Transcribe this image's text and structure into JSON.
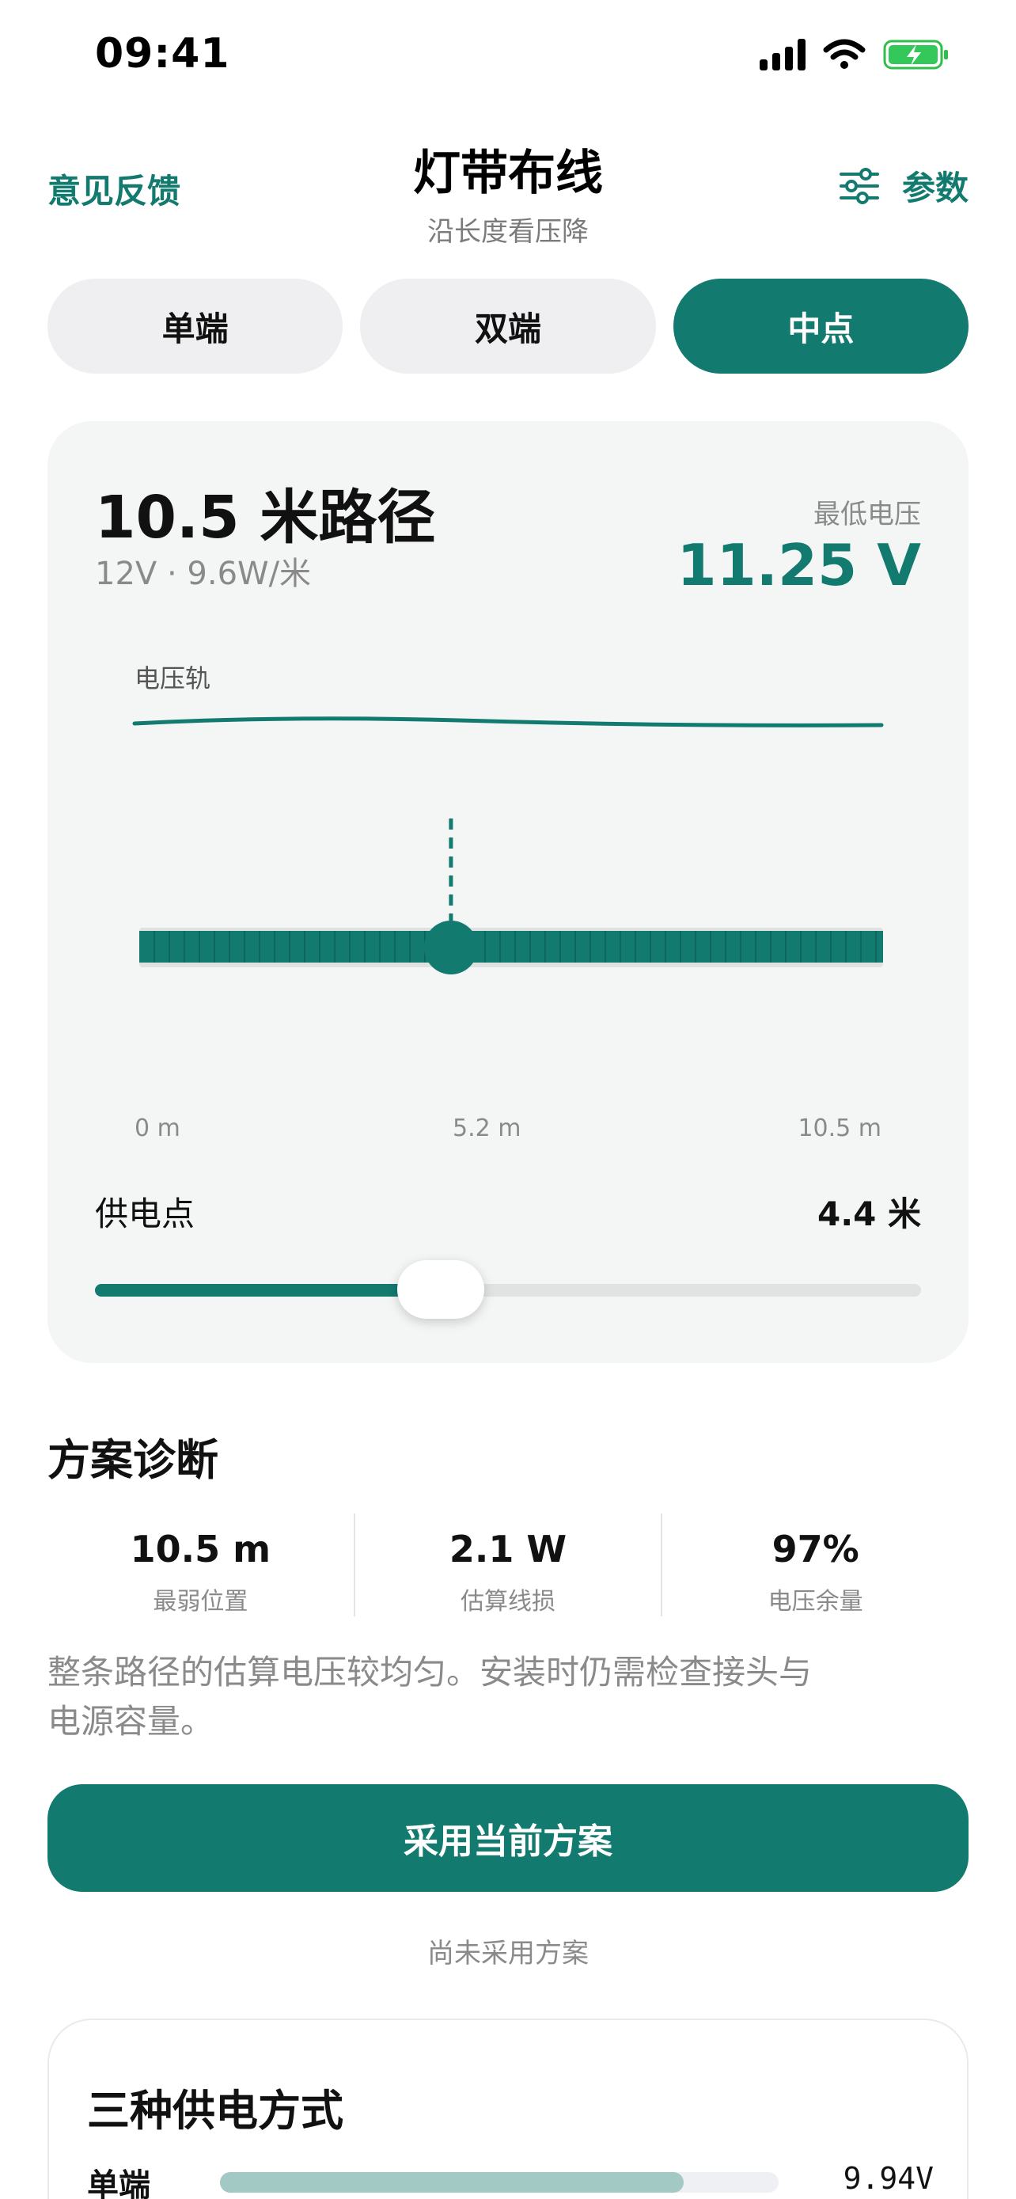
{
  "status": {
    "time": "09:41"
  },
  "header": {
    "feedback": "意见反馈",
    "title": "灯带布线",
    "subtitle": "沿长度看压降",
    "params": "参数"
  },
  "segments": [
    {
      "label": "单端",
      "active": false
    },
    {
      "label": "双端",
      "active": false
    },
    {
      "label": "中点",
      "active": true
    }
  ],
  "route": {
    "title": "10.5 米路径",
    "spec": "12V · 9.6W/米",
    "min_voltage_label": "最低电压",
    "min_voltage": "11.25 V",
    "rail_label": "电压轨",
    "length_m": 10.5,
    "feed_point_m": 4.4,
    "axis": [
      "0 m",
      "5.2 m",
      "10.5 m"
    ],
    "feed_label": "供电点",
    "feed_value": "4.4 米"
  },
  "colors": {
    "accent": "#137a6f",
    "muted": "#8a8a8a",
    "bar_light": "#a3c9c4"
  },
  "diagnostics": {
    "title": "方案诊断",
    "metrics": [
      {
        "value": "10.5 m",
        "label": "最弱位置"
      },
      {
        "value": "2.1 W",
        "label": "估算线损"
      },
      {
        "value": "97%",
        "label": "电压余量"
      }
    ],
    "text": "整条路径的估算电压较均匀。安装时仍需检查接头与电源容量。",
    "button": "采用当前方案",
    "status": "尚未采用方案"
  },
  "modes": {
    "title": "三种供电方式",
    "rows": [
      {
        "name": "单端",
        "value": "9.94V",
        "fraction": 0.83
      }
    ]
  }
}
